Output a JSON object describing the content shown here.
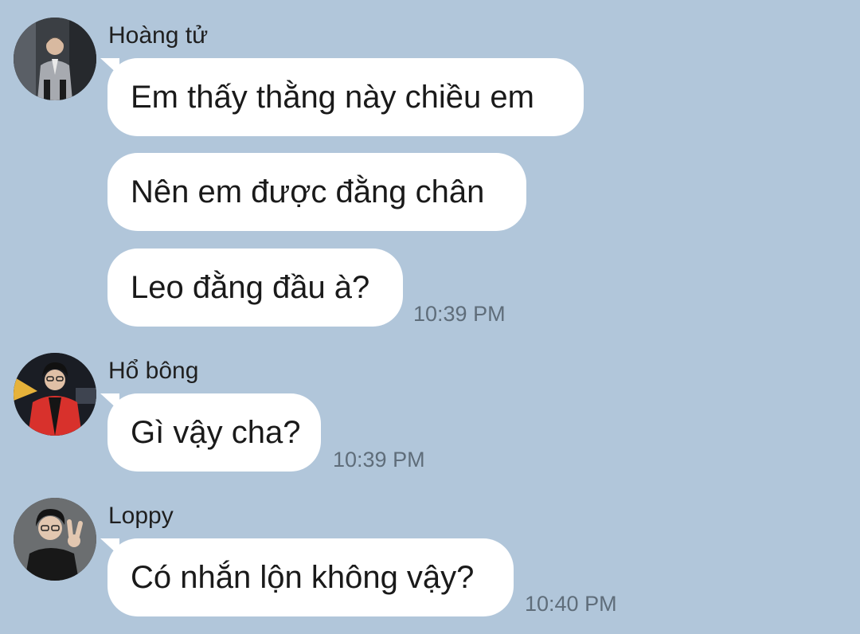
{
  "chat": {
    "groups": [
      {
        "sender": "Hoàng tử",
        "avatar": "avatar-man-in-suit",
        "messages": [
          "Em thấy thằng này chiều em",
          "Nên em được đằng chân",
          "Leo đằng đầu à?"
        ],
        "time": "10:39 PM"
      },
      {
        "sender": "Hổ bông",
        "avatar": "avatar-red-jacket",
        "messages": [
          "Gì vậy cha?"
        ],
        "time": "10:39 PM"
      },
      {
        "sender": "Loppy",
        "avatar": "avatar-peace-sign",
        "messages": [
          "Có nhắn lộn không vậy?"
        ],
        "time": "10:40 PM"
      }
    ]
  },
  "colors": {
    "background": "#b1c6da",
    "bubble": "#ffffff",
    "timestamp": "#5f6d7a"
  }
}
